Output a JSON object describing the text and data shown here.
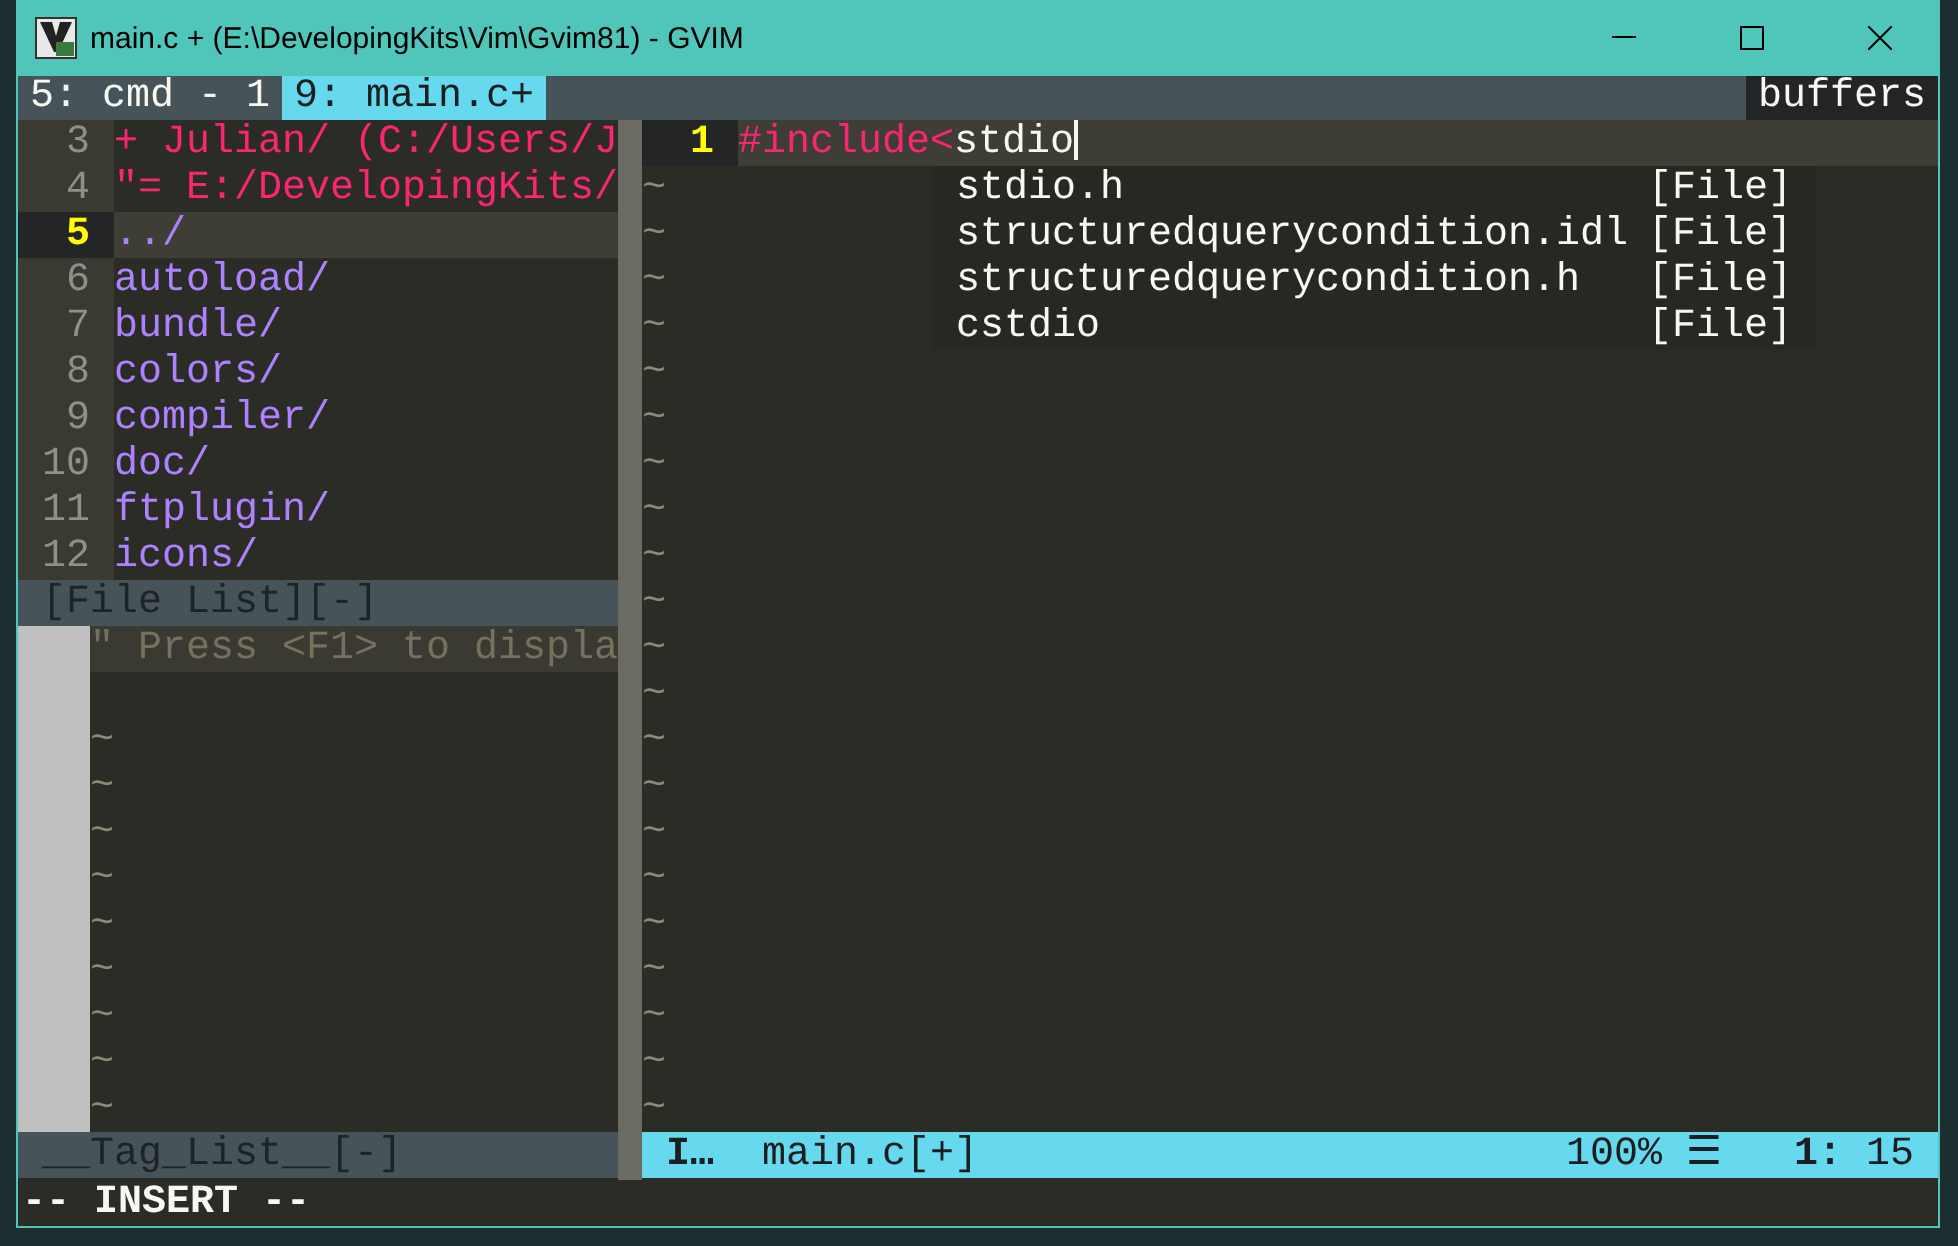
{
  "window": {
    "title": "main.c + (E:\\DevelopingKits\\Vim\\Gvim81) - GVIM"
  },
  "tabline": {
    "tabs": [
      {
        "label": "5: cmd - 1",
        "selected": false
      },
      {
        "label": "9: main.c+",
        "selected": true
      }
    ],
    "buffers_label": "buffers"
  },
  "file_list": {
    "lines": [
      {
        "number": "3",
        "text": "+ Julian/ (C:/Users/J",
        "kind": "bookmark",
        "selected": false
      },
      {
        "number": "4",
        "text": "\"= E:/DevelopingKits/",
        "kind": "bookmark",
        "selected": false
      },
      {
        "number": "5",
        "text": "../",
        "kind": "directory",
        "selected": true
      },
      {
        "number": "6",
        "text": "autoload/",
        "kind": "directory",
        "selected": false
      },
      {
        "number": "7",
        "text": "bundle/",
        "kind": "directory",
        "selected": false
      },
      {
        "number": "8",
        "text": "colors/",
        "kind": "directory",
        "selected": false
      },
      {
        "number": "9",
        "text": "compiler/",
        "kind": "directory",
        "selected": false
      },
      {
        "number": "10",
        "text": "doc/",
        "kind": "directory",
        "selected": false
      },
      {
        "number": "11",
        "text": "ftplugin/",
        "kind": "directory",
        "selected": false
      },
      {
        "number": "12",
        "text": "icons/",
        "kind": "directory",
        "selected": false
      }
    ],
    "status": "[File List][-]"
  },
  "tag_list": {
    "help_text": "\" Press <F1> to displa",
    "empty_lines": [
      "~",
      "~",
      "~",
      "~",
      "~",
      "~",
      "~",
      "~",
      "~"
    ],
    "status": "__Tag_List__[-]"
  },
  "editor": {
    "lines": [
      {
        "number": "1",
        "directive": "#include<",
        "text": "stdio"
      }
    ],
    "empty_lines": [
      "~",
      "~",
      "~",
      "~",
      "~",
      "~",
      "~",
      "~",
      "~",
      "~",
      "~",
      "~",
      "~",
      "~",
      "~",
      "~",
      "~",
      "~",
      "~",
      "~",
      "~"
    ],
    "completion_menu": [
      {
        "name": "stdio.h",
        "kind_label": "[File]"
      },
      {
        "name": "structuredquerycondition.idl",
        "kind_label": "[File]"
      },
      {
        "name": "structuredquerycondition.h",
        "kind_label": "[File]"
      },
      {
        "name": "cstdio",
        "kind_label": "[File]"
      }
    ],
    "status": {
      "mode": "I…",
      "file": "main.c[+]",
      "percent": "100%",
      "symbol": "☰",
      "line": "1:",
      "column": "15"
    }
  },
  "command_line": "-- INSERT --"
}
